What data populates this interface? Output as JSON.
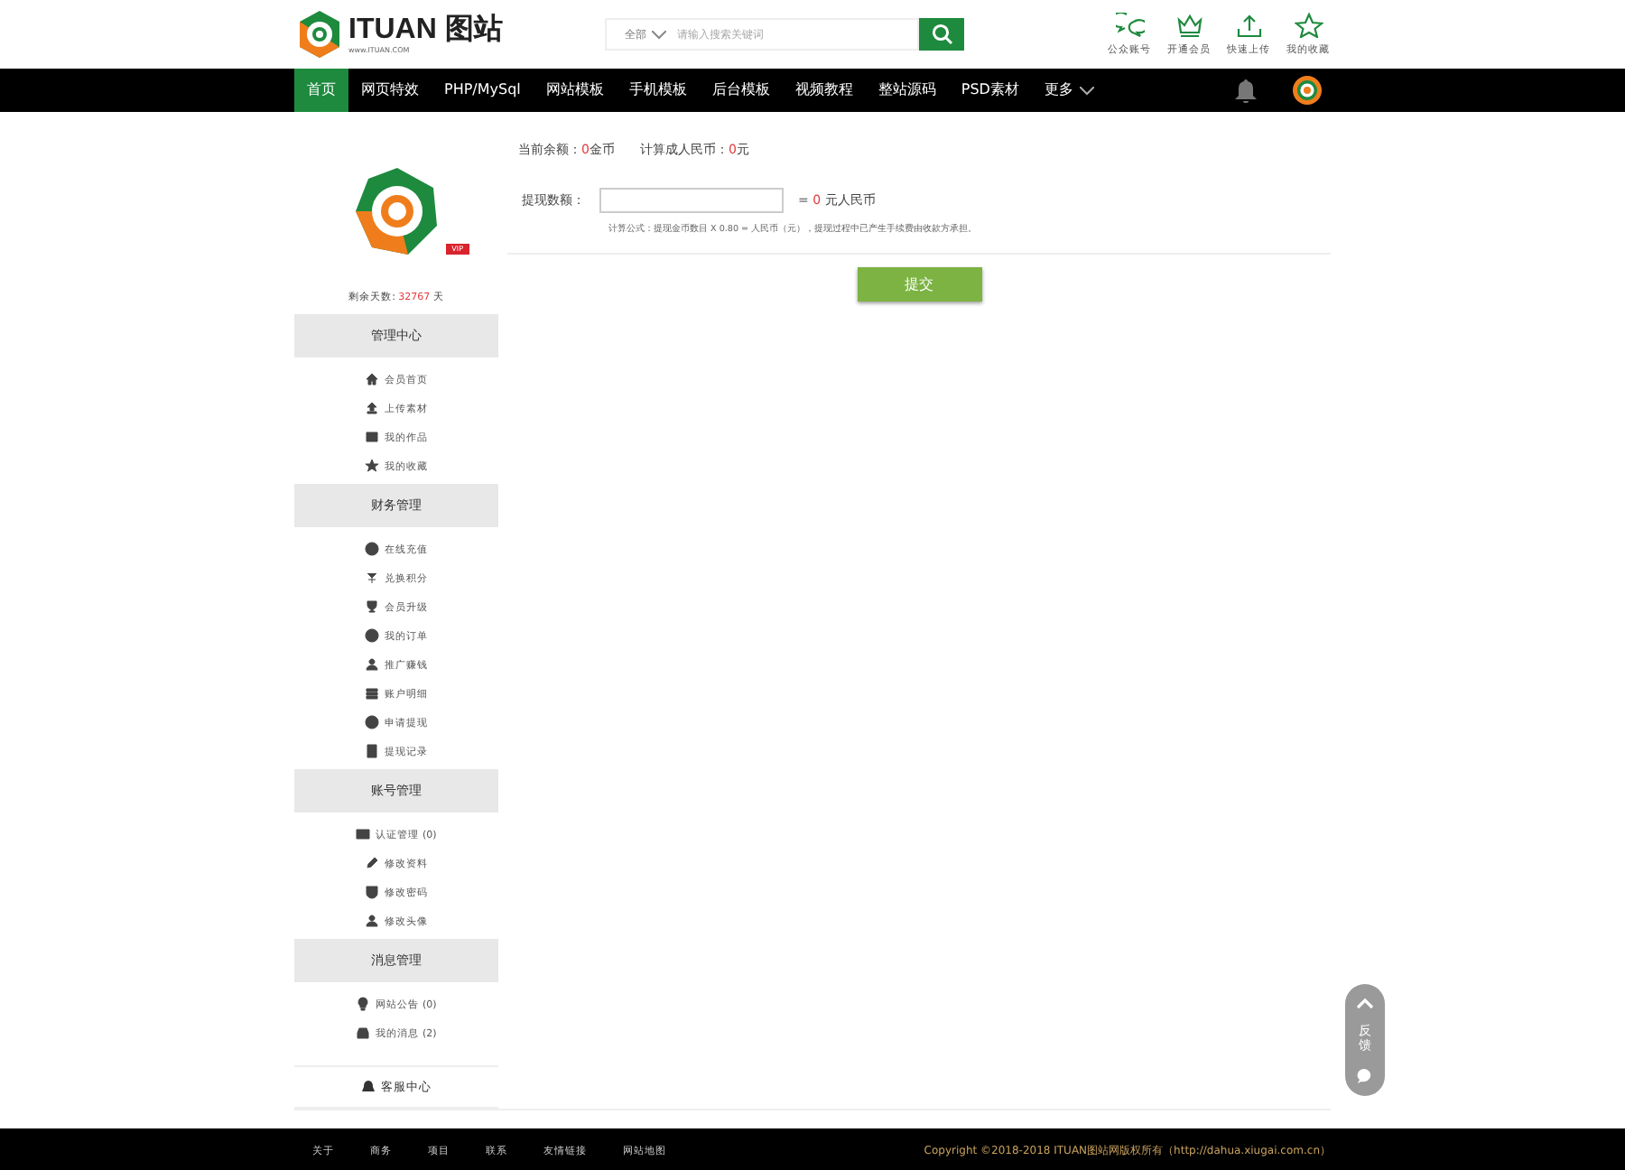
{
  "header": {
    "logo_text": "ITUAN",
    "logo_cn": "图站",
    "logo_url": "www.ITUAN.COM",
    "search": {
      "category": "全部",
      "placeholder": "请输入搜索关键词"
    },
    "shortcuts": [
      "公众账号",
      "开通会员",
      "快速上传",
      "我的收藏"
    ]
  },
  "nav": {
    "items": [
      {
        "label": "首页",
        "selected": true
      },
      {
        "label": "网页特效",
        "selected": false
      },
      {
        "label": "PHP/MySql",
        "selected": false
      },
      {
        "label": "网站模板",
        "selected": false
      },
      {
        "label": "手机模板",
        "selected": false
      },
      {
        "label": "后台模板",
        "selected": false
      },
      {
        "label": "视频教程",
        "selected": false
      },
      {
        "label": "整站源码",
        "selected": false
      },
      {
        "label": "PSD素材",
        "selected": false
      }
    ],
    "more": "更多"
  },
  "profile": {
    "badge": "VIP",
    "days_label": "剩余天数:",
    "days": "32767",
    "days_unit": "天"
  },
  "sidebar": {
    "sections": [
      {
        "title": "管理中心",
        "items": [
          "会员首页",
          "上传素材",
          "我的作品",
          "我的收藏"
        ]
      },
      {
        "title": "财务管理",
        "items": [
          "在线充值",
          "兑换积分",
          "会员升级",
          "我的订单",
          "推广赚钱",
          "账户明细",
          "申请提现",
          "提现记录"
        ]
      },
      {
        "title": "账号管理",
        "items": [
          "认证管理 (0)",
          "修改资料",
          "修改密码",
          "修改头像"
        ]
      },
      {
        "title": "消息管理",
        "items": [
          "网站公告 (0)",
          "我的消息 (2)"
        ]
      }
    ],
    "service": "客服中心"
  },
  "withdraw": {
    "balance_label": "当前余额：",
    "balance": "0",
    "balance_unit": "金币",
    "rmb_label": "计算成人民币：",
    "rmb": "0",
    "rmb_unit": "元",
    "amount_label": "提现数额：",
    "result_prefix": "=",
    "result": "0",
    "result_unit": "元人民币",
    "formula": "计算公式：提现金币数目 X 0.80 = 人民币（元），提现过程中已产生手续费由收款方承担。",
    "submit": "提交"
  },
  "side_tools": {
    "feedback": "反馈"
  },
  "footer": {
    "links": [
      "关于",
      "商务",
      "项目",
      "联系",
      "友情链接",
      "网站地图"
    ],
    "copyright": "Copyright ©2018-2018 ITUAN图站网版权所有（http://dahua.xiugai.com.cn）"
  }
}
